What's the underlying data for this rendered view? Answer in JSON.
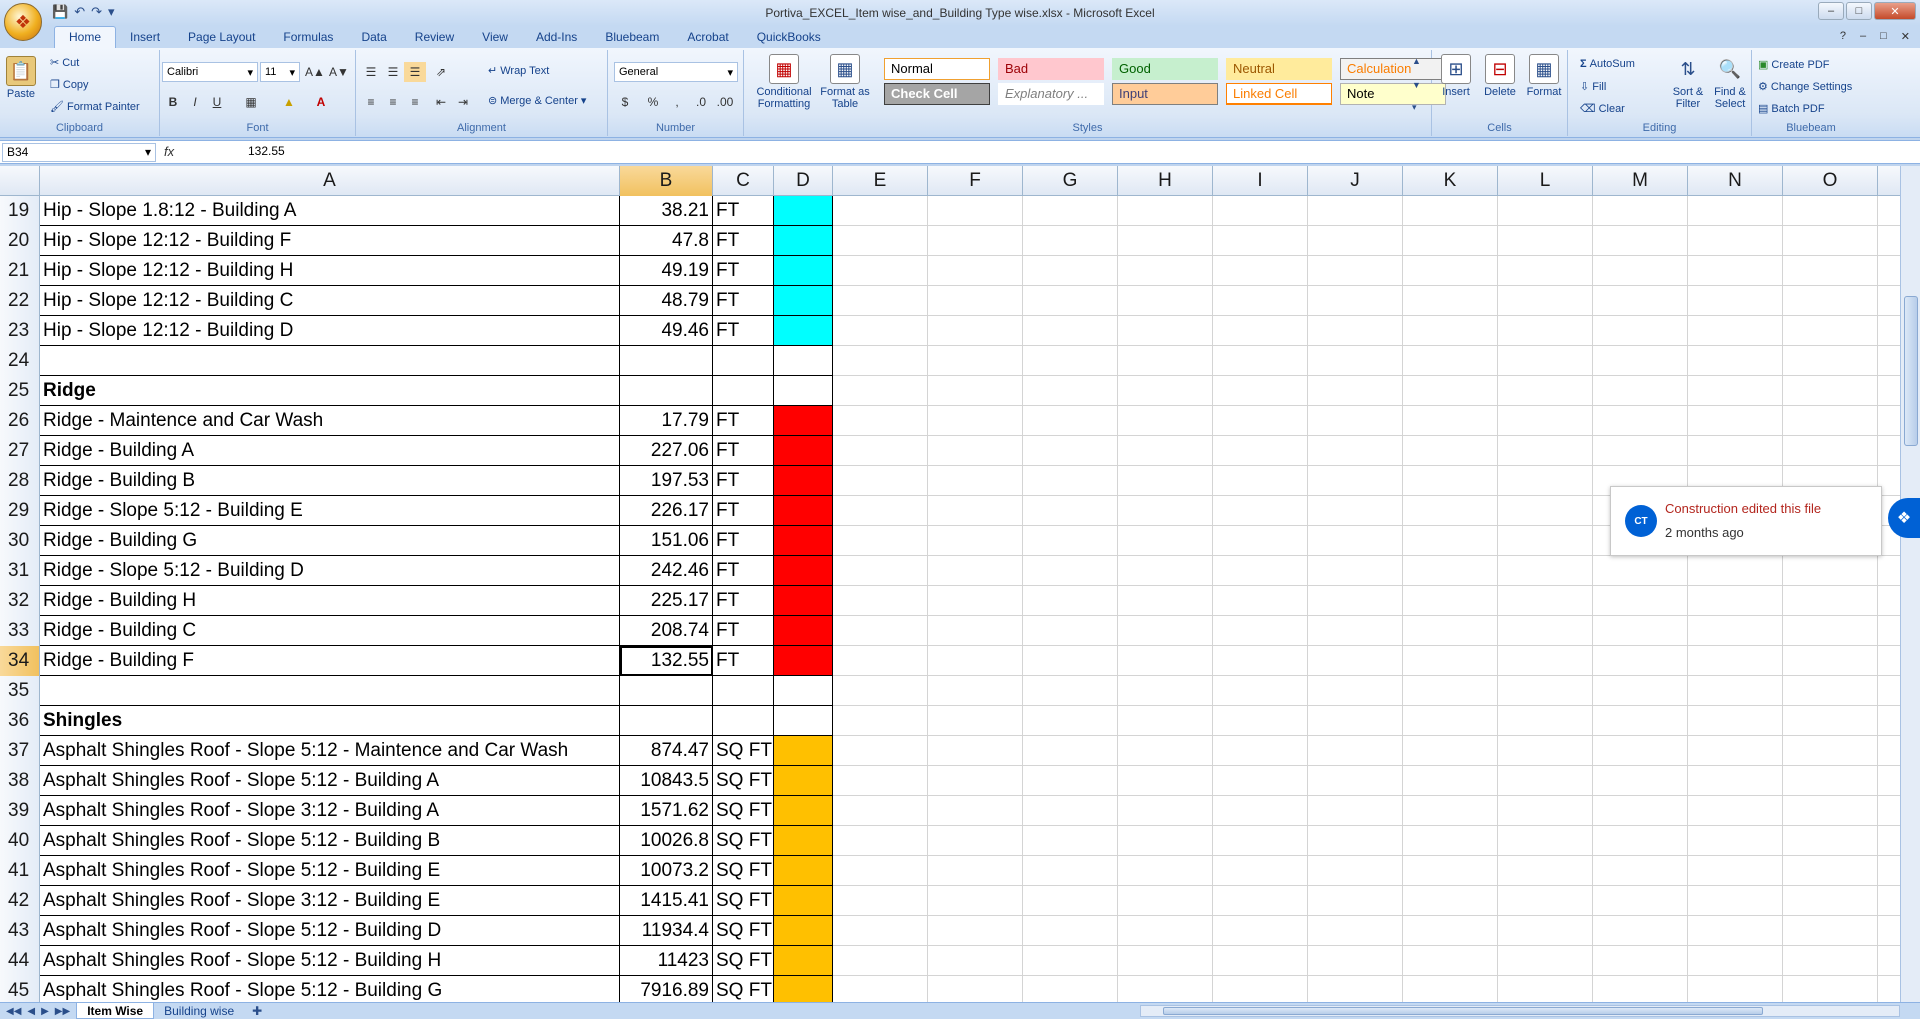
{
  "window": {
    "title": "Portiva_EXCEL_Item wise_and_Building Type wise.xlsx - Microsoft Excel"
  },
  "ribbon_tabs": [
    "Home",
    "Insert",
    "Page Layout",
    "Formulas",
    "Data",
    "Review",
    "View",
    "Add-Ins",
    "Bluebeam",
    "Acrobat",
    "QuickBooks"
  ],
  "ribbon": {
    "clipboard": {
      "label": "Clipboard",
      "paste": "Paste",
      "cut": "Cut",
      "copy": "Copy",
      "format_painter": "Format Painter"
    },
    "font": {
      "label": "Font",
      "name": "Calibri",
      "size": "11"
    },
    "alignment": {
      "label": "Alignment",
      "wrap": "Wrap Text",
      "merge": "Merge & Center"
    },
    "number": {
      "label": "Number",
      "format": "General"
    },
    "styles": {
      "label": "Styles",
      "conditional": "Conditional Formatting",
      "format_table": "Format as Table",
      "cells": [
        {
          "name": "Normal",
          "bg": "#ffffff",
          "fg": "#000000",
          "border": "#f0a030"
        },
        {
          "name": "Bad",
          "bg": "#ffc7ce",
          "fg": "#9c0006",
          "border": "#ffc7ce"
        },
        {
          "name": "Good",
          "bg": "#c6efce",
          "fg": "#006100",
          "border": "#c6efce"
        },
        {
          "name": "Neutral",
          "bg": "#ffeb9c",
          "fg": "#9c5700",
          "border": "#ffeb9c"
        },
        {
          "name": "Calculation",
          "bg": "#f2f2f2",
          "fg": "#fa7d00",
          "border": "#7f7f7f"
        },
        {
          "name": "Check Cell",
          "bg": "#a5a5a5",
          "fg": "#ffffff",
          "border": "#3f3f3f"
        },
        {
          "name": "Explanatory ...",
          "bg": "#ffffff",
          "fg": "#7f7f7f",
          "border": "#ffffff"
        },
        {
          "name": "Input",
          "bg": "#ffcc99",
          "fg": "#3f3f76",
          "border": "#7f7f7f"
        },
        {
          "name": "Linked Cell",
          "bg": "#ffffff",
          "fg": "#fa7d00",
          "border": "#ff8001"
        },
        {
          "name": "Note",
          "bg": "#ffffcc",
          "fg": "#000000",
          "border": "#b2b2b2"
        }
      ]
    },
    "cells": {
      "label": "Cells",
      "insert": "Insert",
      "delete": "Delete",
      "format": "Format"
    },
    "editing": {
      "label": "Editing",
      "autosum": "AutoSum",
      "fill": "Fill",
      "clear": "Clear",
      "sort": "Sort & Filter",
      "find": "Find & Select"
    },
    "bluebeam": {
      "label": "Bluebeam",
      "create": "Create PDF",
      "change": "Change Settings",
      "batch": "Batch PDF"
    }
  },
  "formula_bar": {
    "name_box": "B34",
    "fx": "fx",
    "value": "132.55"
  },
  "columns": [
    "A",
    "B",
    "C",
    "D",
    "E",
    "F",
    "G",
    "H",
    "I",
    "J",
    "K",
    "L",
    "M",
    "N",
    "O"
  ],
  "colors": {
    "cyan": "#00ffff",
    "red": "#ff0000",
    "amber": "#ffc000"
  },
  "rows": [
    {
      "n": "19",
      "a": "Hip - Slope 1.8:12 - Building A",
      "b": "38.21",
      "c": "FT",
      "d": "cyan"
    },
    {
      "n": "20",
      "a": "Hip - Slope 12:12 - Building F",
      "b": "47.8",
      "c": "FT",
      "d": "cyan"
    },
    {
      "n": "21",
      "a": "Hip - Slope 12:12 - Building H",
      "b": "49.19",
      "c": "FT",
      "d": "cyan"
    },
    {
      "n": "22",
      "a": "Hip - Slope 12:12 - Building C",
      "b": "48.79",
      "c": "FT",
      "d": "cyan"
    },
    {
      "n": "23",
      "a": "Hip - Slope 12:12 - Building D",
      "b": "49.46",
      "c": "FT",
      "d": "cyan"
    },
    {
      "n": "24",
      "a": "",
      "b": "",
      "c": "",
      "d": ""
    },
    {
      "n": "25",
      "a": "Ridge",
      "b": "",
      "c": "",
      "d": "",
      "bold": true
    },
    {
      "n": "26",
      "a": "Ridge - Maintence and Car Wash",
      "b": "17.79",
      "c": "FT",
      "d": "red"
    },
    {
      "n": "27",
      "a": "Ridge - Building A",
      "b": "227.06",
      "c": "FT",
      "d": "red"
    },
    {
      "n": "28",
      "a": "Ridge - Building B",
      "b": "197.53",
      "c": "FT",
      "d": "red"
    },
    {
      "n": "29",
      "a": "Ridge - Slope 5:12 - Building E",
      "b": "226.17",
      "c": "FT",
      "d": "red"
    },
    {
      "n": "30",
      "a": "Ridge - Building G",
      "b": "151.06",
      "c": "FT",
      "d": "red"
    },
    {
      "n": "31",
      "a": "Ridge - Slope 5:12 - Building D",
      "b": "242.46",
      "c": "FT",
      "d": "red"
    },
    {
      "n": "32",
      "a": "Ridge - Building H",
      "b": "225.17",
      "c": "FT",
      "d": "red"
    },
    {
      "n": "33",
      "a": "Ridge - Building C",
      "b": "208.74",
      "c": "FT",
      "d": "red"
    },
    {
      "n": "34",
      "a": "Ridge - Building F",
      "b": "132.55",
      "c": "FT",
      "d": "red",
      "active": true
    },
    {
      "n": "35",
      "a": "",
      "b": "",
      "c": "",
      "d": ""
    },
    {
      "n": "36",
      "a": "Shingles",
      "b": "",
      "c": "",
      "d": "",
      "bold": true
    },
    {
      "n": "37",
      "a": "Asphalt Shingles Roof  - Slope 5:12 - Maintence and Car Wash",
      "b": "874.47",
      "c": "SQ FT",
      "d": "amber"
    },
    {
      "n": "38",
      "a": "Asphalt Shingles Roof  - Slope 5:12 - Building A",
      "b": "10843.5",
      "c": "SQ FT",
      "d": "amber"
    },
    {
      "n": "39",
      "a": "Asphalt Shingles Roof  - Slope 3:12 - Building A",
      "b": "1571.62",
      "c": "SQ FT",
      "d": "amber"
    },
    {
      "n": "40",
      "a": "Asphalt Shingles Roof  - Slope 5:12 - Building B",
      "b": "10026.8",
      "c": "SQ FT",
      "d": "amber"
    },
    {
      "n": "41",
      "a": "Asphalt Shingles Roof  - Slope 5:12 - Building E",
      "b": "10073.2",
      "c": "SQ FT",
      "d": "amber"
    },
    {
      "n": "42",
      "a": "Asphalt Shingles Roof  - Slope 3:12 - Building E",
      "b": "1415.41",
      "c": "SQ FT",
      "d": "amber"
    },
    {
      "n": "43",
      "a": "Asphalt Shingles Roof  - Slope 5:12 - Building D",
      "b": "11934.4",
      "c": "SQ FT",
      "d": "amber"
    },
    {
      "n": "44",
      "a": "Asphalt Shingles Roof  - Slope 5:12 - Building H",
      "b": "11423",
      "c": "SQ FT",
      "d": "amber"
    },
    {
      "n": "45",
      "a": "Asphalt Shingles Roof  - Slope 5:12 - Building G",
      "b": "7916.89",
      "c": "SQ FT",
      "d": "amber"
    }
  ],
  "sheets": [
    "Item Wise",
    "Building wise"
  ],
  "notification": {
    "initials": "CT",
    "title": "Construction edited this file",
    "time": "2 months ago"
  }
}
